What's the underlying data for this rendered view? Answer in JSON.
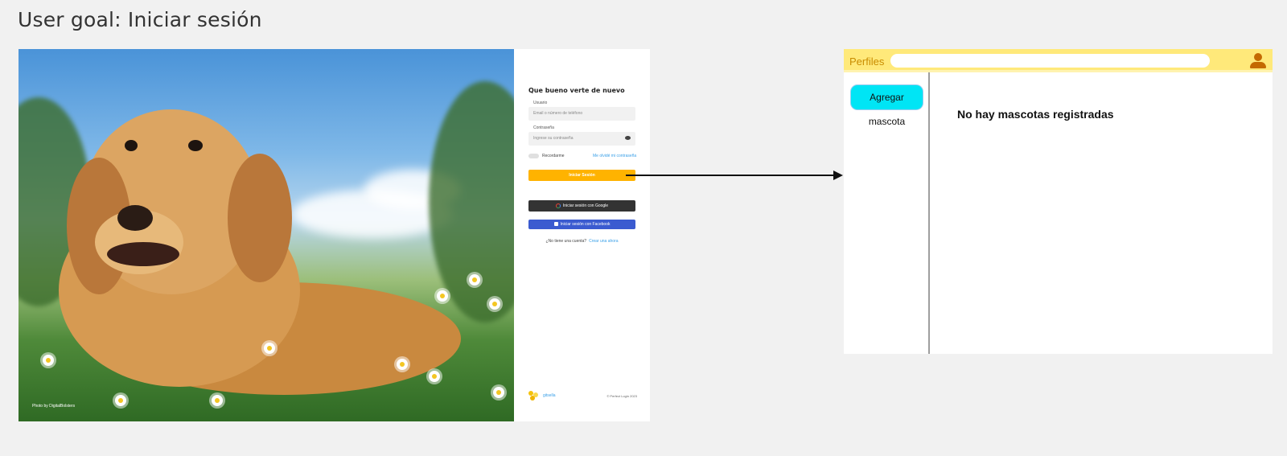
{
  "page": {
    "goal_title": "User goal: Iniciar sesión"
  },
  "login": {
    "photo_credit": "Photo by DigitalBolsters",
    "title": "Que bueno verte de nuevo",
    "user_label": "Usuario",
    "user_placeholder": "Email o número de teléfono",
    "password_label": "Contraseña",
    "password_placeholder": "Ingrese su contraseña",
    "remember_label": "Recordarme",
    "forgot_link": "Me olvidé mi contraseña",
    "login_button": "Iniciar Sesión",
    "google_button": "Iniciar sesión con Google",
    "facebook_button": "Iniciar sesión con Facebook",
    "no_account_text": "¿No tiene una cuenta?",
    "create_account_link": "Crear una ahora",
    "brand_name": "gitsella",
    "copyright": "© Perfect Login 2023",
    "accent_color": "#ffb300"
  },
  "profiles": {
    "title": "Perfiles",
    "search_value": "",
    "add_pet_button": "Agregar mascota",
    "empty_message": "No hay mascotas registradas",
    "topbar_color": "#ffe97a",
    "button_color": "#00e5f5"
  }
}
